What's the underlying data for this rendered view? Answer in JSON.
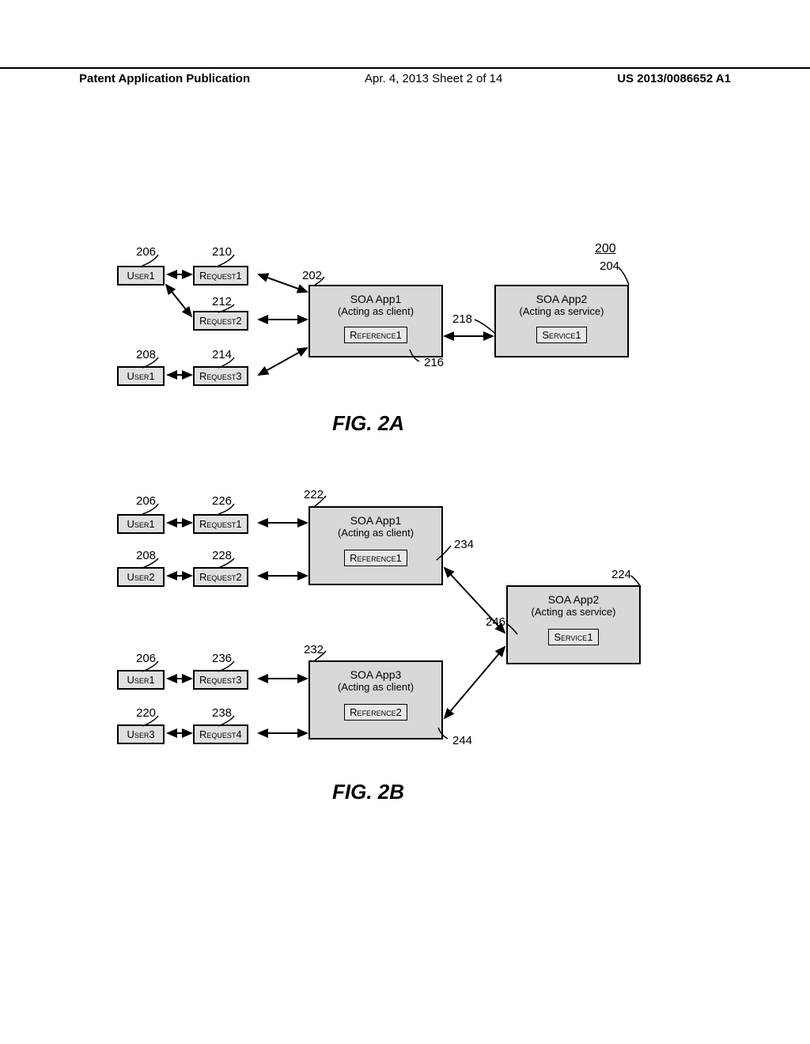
{
  "header": {
    "left": "Patent Application Publication",
    "mid": "Apr. 4, 2013  Sheet 2 of 14",
    "right": "US 2013/0086652 A1"
  },
  "figA": {
    "caption": "FIG. 2A",
    "num200": "200",
    "labels": {
      "l206": "206",
      "l210": "210",
      "l202": "202",
      "l204": "204",
      "l212": "212",
      "l218": "218",
      "l216": "216",
      "l208": "208",
      "l214": "214"
    },
    "user1a": "User1",
    "user1b": "User1",
    "req1": "Request1",
    "req2": "Request2",
    "req3": "Request3",
    "app1_title": "SOA App1",
    "app1_sub": "(Acting as client)",
    "ref1": "Reference1",
    "app2_title": "SOA App2",
    "app2_sub": "(Acting as service)",
    "svc1": "Service1"
  },
  "figB": {
    "caption": "FIG. 2B",
    "labels": {
      "l206a": "206",
      "l226": "226",
      "l222": "222",
      "l234": "234",
      "l208": "208",
      "l228": "228",
      "l224": "224",
      "l246": "246",
      "l206b": "206",
      "l236": "236",
      "l232": "232",
      "l220": "220",
      "l238": "238",
      "l244": "244"
    },
    "user1a": "User1",
    "user2": "User2",
    "user1b": "User1",
    "user3": "User3",
    "req1": "Request1",
    "req2": "Request2",
    "req3": "Request3",
    "req4": "Request4",
    "app1_title": "SOA App1",
    "app1_sub": "(Acting as client)",
    "ref1": "Reference1",
    "app3_title": "SOA App3",
    "app3_sub": "(Acting as client)",
    "ref2": "Reference2",
    "app2_title": "SOA App2",
    "app2_sub": "(Acting as service)",
    "svc1": "Service1"
  }
}
